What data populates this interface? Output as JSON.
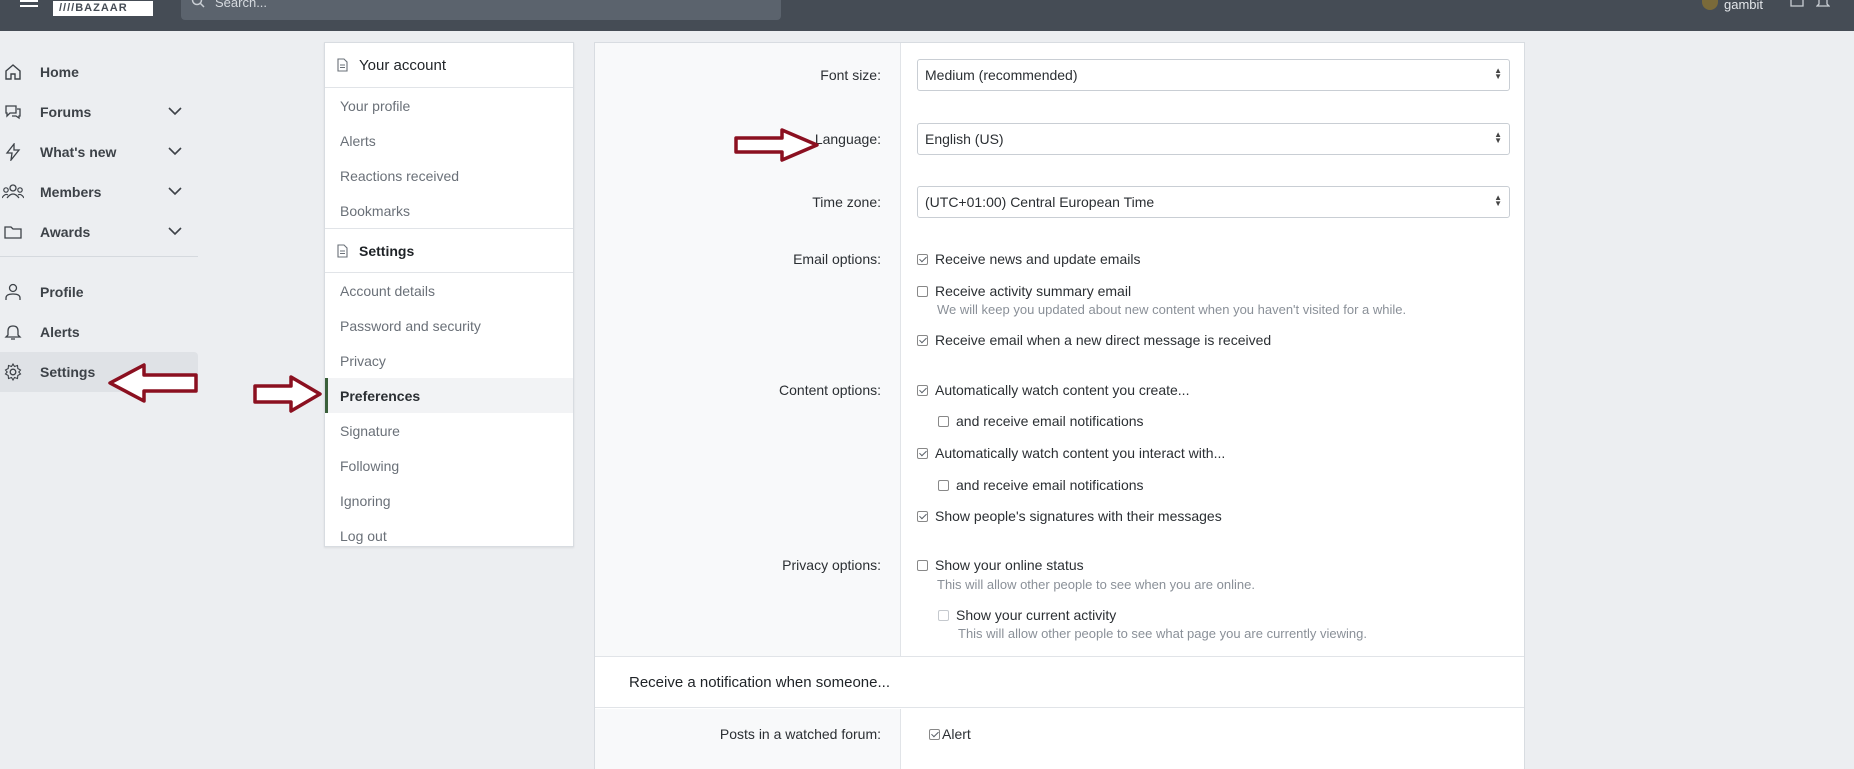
{
  "topbar": {
    "logo": "////BAZAAR",
    "search_placeholder": "Search...",
    "username": "gambit"
  },
  "leftnav": {
    "items": [
      {
        "label": "Home"
      },
      {
        "label": "Forums"
      },
      {
        "label": "What's new"
      },
      {
        "label": "Members"
      },
      {
        "label": "Awards"
      },
      {
        "label": "Profile"
      },
      {
        "label": "Alerts"
      },
      {
        "label": "Settings"
      }
    ]
  },
  "account": {
    "header": "Your account",
    "items": [
      "Your profile",
      "Alerts",
      "Reactions received",
      "Bookmarks"
    ],
    "settings_header": "Settings",
    "settings_items": [
      "Account details",
      "Password and security",
      "Privacy",
      "Preferences",
      "Signature",
      "Following",
      "Ignoring",
      "Log out"
    ]
  },
  "prefs": {
    "font_size_label": "Font size:",
    "font_size_value": "Medium (recommended)",
    "language_label": "Language:",
    "language_value": "English (US)",
    "timezone_label": "Time zone:",
    "timezone_value": "(UTC+01:00) Central European Time",
    "email_label": "Email options:",
    "email_opt1": "Receive news and update emails",
    "email_opt2": "Receive activity summary email",
    "email_opt2_hint": "We will keep you updated about new content when you haven't visited for a while.",
    "email_opt3": "Receive email when a new direct message is received",
    "content_label": "Content options:",
    "content_opt1": "Automatically watch content you create...",
    "content_opt1_sub": "and receive email notifications",
    "content_opt2": "Automatically watch content you interact with...",
    "content_opt2_sub": "and receive email notifications",
    "content_opt3": "Show people's signatures with their messages",
    "privacy_label": "Privacy options:",
    "privacy_opt1": "Show your online status",
    "privacy_opt1_hint": "This will allow other people to see when you are online.",
    "privacy_opt2": "Show your current activity",
    "privacy_opt2_hint": "This will allow other people to see what page you are currently viewing.",
    "notify_section": "Receive a notification when someone...",
    "posts_label": "Posts in a watched forum:",
    "posts_alert": "Alert"
  },
  "colors": {
    "topbar": "#454c55",
    "arrow": "#8b1020",
    "selected_border": "#3a5f3a"
  }
}
